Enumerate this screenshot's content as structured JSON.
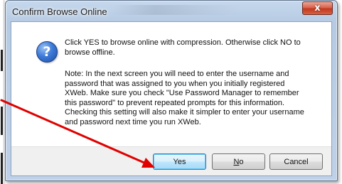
{
  "dialog": {
    "title": "Confirm Browse Online",
    "close_glyph": "x",
    "icon": "question-icon",
    "message_main": "Click YES to browse online with compression. Otherwise click NO to browse offline.",
    "message_note": "Note: In the next screen you will need to enter the username and password that was assigned to you when you initially registered XWeb. Make sure you check \"Use Password Manager to remember this password\" to prevent repeated prompts for this information. Checking this setting will also make it simpler to enter your username and password next time you run XWeb."
  },
  "buttons": {
    "yes_label": "Yes",
    "no_label_prefix": "",
    "no_label_underlined": "N",
    "no_label_rest": "o",
    "cancel_label": "Cancel"
  },
  "annotation": {
    "type": "arrow",
    "color": "#e00000",
    "points_to": "yes-button"
  },
  "colors": {
    "close_button": "#c94a31",
    "default_button_border": "#3c7fb1",
    "icon_blue": "#3d7ad8"
  }
}
